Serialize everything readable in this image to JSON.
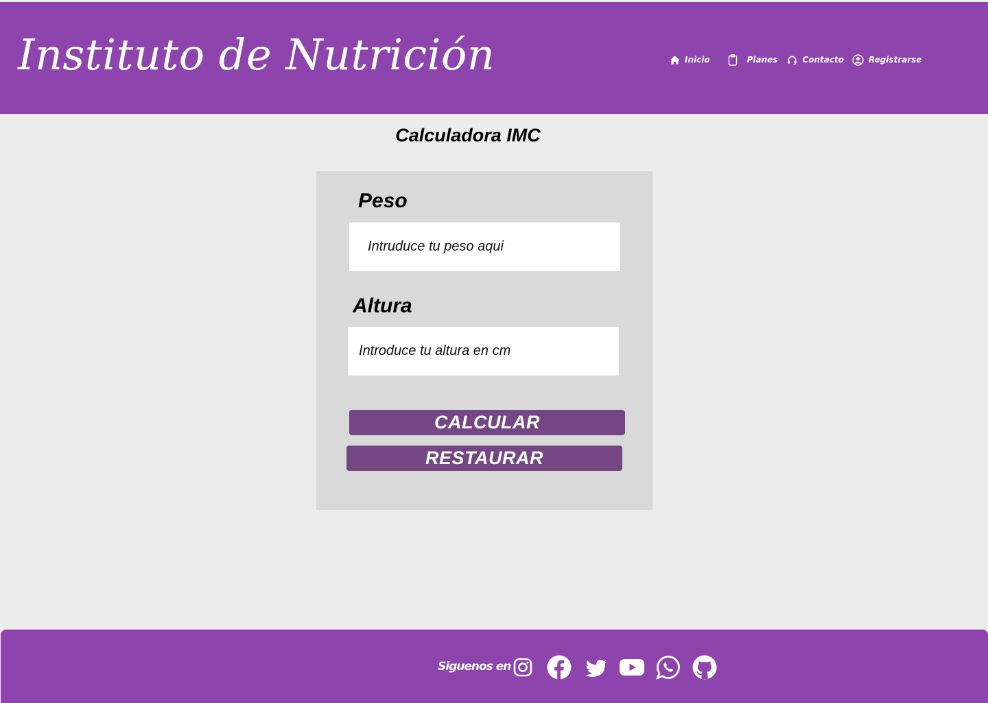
{
  "header": {
    "logo_text": "Instituto  de Nutrición",
    "nav": [
      {
        "label": "Inicio",
        "icon": "home-icon"
      },
      {
        "label": "Planes",
        "icon": "clipboard-icon"
      },
      {
        "label": "Contacto",
        "icon": "headset-icon"
      },
      {
        "label": "Registrarse",
        "icon": "user-circle-icon"
      }
    ]
  },
  "main": {
    "title": "Calculadora IMC",
    "form": {
      "peso_label": "Peso",
      "peso_placeholder": "Intruduce tu peso aqui",
      "altura_label": "Altura",
      "altura_placeholder": "Introduce tu altura en cm",
      "calcular_label": "CALCULAR",
      "restaurar_label": "RESTAURAR"
    }
  },
  "footer": {
    "follow_label": "Siguenos en",
    "social": [
      "instagram-icon",
      "facebook-icon",
      "twitter-icon",
      "youtube-icon",
      "whatsapp-icon",
      "github-icon"
    ]
  },
  "colors": {
    "brand_purple": "#8e44ad",
    "button_purple": "#744784",
    "card_bg": "#d9d9d9",
    "page_bg": "#ececec"
  }
}
